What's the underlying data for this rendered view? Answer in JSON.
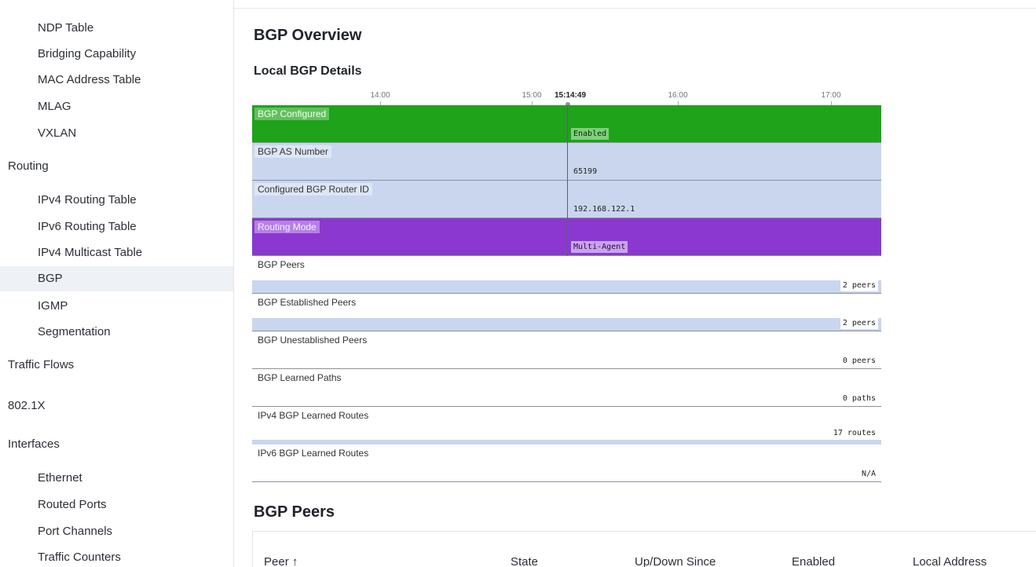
{
  "sidebar": {
    "items": [
      {
        "label": "NDP Table",
        "level": "sub"
      },
      {
        "label": "Bridging Capability",
        "level": "sub"
      },
      {
        "label": "MAC Address Table",
        "level": "sub"
      },
      {
        "label": "MLAG",
        "level": "sub"
      },
      {
        "label": "VXLAN",
        "level": "sub"
      },
      {
        "label": "Routing",
        "level": "top"
      },
      {
        "label": "IPv4 Routing Table",
        "level": "sub"
      },
      {
        "label": "IPv6 Routing Table",
        "level": "sub"
      },
      {
        "label": "IPv4 Multicast Table",
        "level": "sub"
      },
      {
        "label": "BGP",
        "level": "sub",
        "active": true
      },
      {
        "label": "IGMP",
        "level": "sub"
      },
      {
        "label": "Segmentation",
        "level": "sub"
      },
      {
        "label": "Traffic Flows",
        "level": "top"
      },
      {
        "label": "802.1X",
        "level": "top"
      },
      {
        "label": "Interfaces",
        "level": "top"
      },
      {
        "label": "Ethernet",
        "level": "sub"
      },
      {
        "label": "Routed Ports",
        "level": "sub"
      },
      {
        "label": "Port Channels",
        "level": "sub"
      },
      {
        "label": "Traffic Counters",
        "level": "sub"
      }
    ]
  },
  "main": {
    "title": "BGP Overview",
    "local_details_title": "Local BGP Details",
    "timeline": {
      "ticks": [
        "14:00",
        "15:00",
        "16:00",
        "17:00"
      ],
      "cursor": "15:14:49",
      "rows": [
        {
          "label": "BGP Configured",
          "value": "Enabled",
          "style": "green"
        },
        {
          "label": "BGP AS Number",
          "value": "65199",
          "style": "blue"
        },
        {
          "label": "Configured BGP Router ID",
          "value": "192.168.122.1",
          "style": "blue"
        },
        {
          "label": "Routing Mode",
          "value": "Multi-Agent",
          "style": "purple"
        },
        {
          "label": "BGP Peers",
          "value": "2 peers",
          "style": "white",
          "bar": true
        },
        {
          "label": "BGP Established Peers",
          "value": "2 peers",
          "style": "white",
          "bar": true
        },
        {
          "label": "BGP Unestablished Peers",
          "value": "0 peers",
          "style": "white",
          "bar": false
        },
        {
          "label": "BGP Learned Paths",
          "value": "0 paths",
          "style": "white",
          "bar": false
        },
        {
          "label": "IPv4 BGP Learned Routes",
          "value": "17 routes",
          "style": "white",
          "bar": true
        },
        {
          "label": "IPv6 BGP Learned Routes",
          "value": "N/A",
          "style": "white",
          "bar": false
        }
      ]
    },
    "peers_title": "BGP Peers",
    "peers_table": {
      "columns": [
        "Peer ↑",
        "State",
        "Up/Down Since",
        "Enabled",
        "Local Address"
      ]
    }
  },
  "colors": {
    "configured_green": "#1ea31a",
    "info_blue": "#c9d6ee",
    "mode_purple": "#8a38cf",
    "active_item_bg": "#eef1f6"
  }
}
